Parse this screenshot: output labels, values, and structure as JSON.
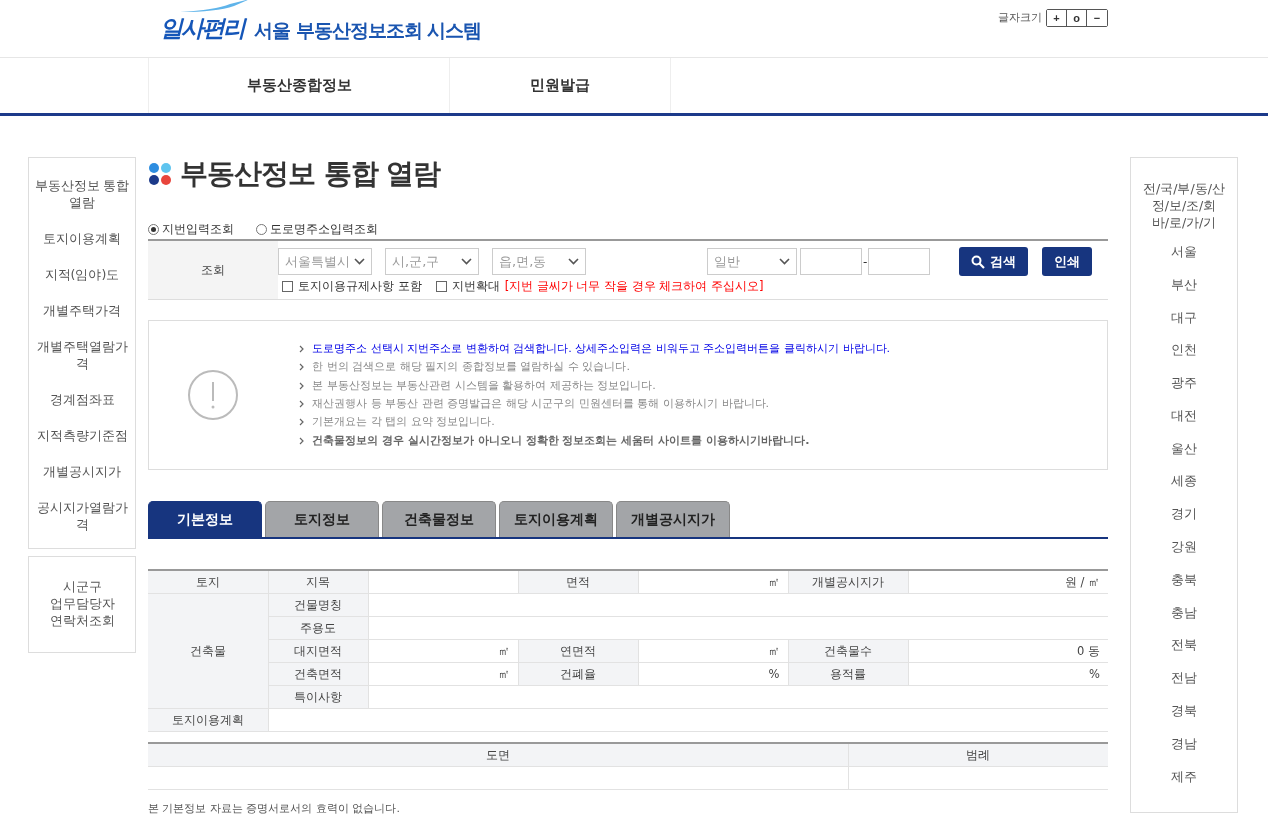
{
  "header": {
    "logo_text": "일사편리",
    "title": "서울 부동산정보조회 시스템",
    "font_size": {
      "label": "글자크기",
      "buttons": [
        "+",
        "o",
        "−"
      ]
    }
  },
  "nav": [
    "부동산종합정보",
    "민원발급"
  ],
  "left_menu": [
    "부동산정보 통합 열람",
    "토지이용계획",
    "지적(임야)도",
    "개별주택가격",
    "개별주택열람가격",
    "경계점좌표",
    "지적측량기준점",
    "개별공시지가",
    "공시지가열람가격"
  ],
  "contact_box": [
    "시군구",
    "업무담당자",
    "연락처조회"
  ],
  "page_title": "부동산정보 통합 열람",
  "search_modes": [
    {
      "label": "지번입력조회",
      "selected": true
    },
    {
      "label": "도로명주소입력조회",
      "selected": false
    }
  ],
  "search": {
    "label": "조회",
    "selects": [
      "서울특별시",
      "시,군,구",
      "읍,면,동"
    ],
    "lot_type": "일반",
    "separator": "-",
    "checkboxes": [
      {
        "label": "토지이용규제사항 포함",
        "checked": false
      },
      {
        "label": "지번확대",
        "checked": false,
        "note": "[지번 글씨가 너무 작을 경우 체크하여 주십시오]"
      }
    ],
    "buttons": [
      {
        "label": "검색",
        "kind": "search"
      },
      {
        "label": "인쇄",
        "kind": "plain"
      }
    ]
  },
  "notices": [
    {
      "text": "도로명주소 선택시 지번주소로 변환하여 검색합니다. 상세주소입력은 비워두고 주소입력버튼을 클릭하시기 바랍니다.",
      "kind": "highlight"
    },
    {
      "text": "한 번의 검색으로 해당 필지의 종합정보를 열람하실 수 있습니다.",
      "kind": "plain"
    },
    {
      "text": "본 부동산정보는 부동산관련 시스템을 활용하여 제공하는 정보입니다.",
      "kind": "plain"
    },
    {
      "text": "재산권행사 등 부동산 관련 증명발급은 해당 시군구의 민원센터를 통해 이용하시기 바랍니다.",
      "kind": "plain"
    },
    {
      "text": "기본개요는 각 탭의 요약 정보입니다.",
      "kind": "plain"
    },
    {
      "text": "건축물정보의 경우 실시간정보가 아니오니 정확한 정보조회는 세움터 사이트를 이용하시기바랍니다.",
      "kind": "strong"
    }
  ],
  "tabs": [
    {
      "label": "기본정보",
      "selected": true
    },
    {
      "label": "토지정보",
      "selected": false
    },
    {
      "label": "건축물정보",
      "selected": false
    },
    {
      "label": "토지이용계획",
      "selected": false
    },
    {
      "label": "개별공시지가",
      "selected": false
    }
  ],
  "info_table": {
    "rows": [
      {
        "group": "토지",
        "cells": [
          {
            "kind": "head",
            "text": "지목"
          },
          {
            "kind": "value"
          },
          {
            "kind": "head",
            "text": "면적"
          },
          {
            "kind": "value",
            "text": "㎡"
          },
          {
            "kind": "head",
            "text": "개별공시지가"
          },
          {
            "kind": "value",
            "text": "원 / ㎡"
          }
        ]
      },
      {
        "group": "건축물",
        "cells": [
          {
            "kind": "head",
            "text": "건물명칭"
          },
          {
            "kind": "wide"
          }
        ]
      },
      {
        "cells": [
          {
            "kind": "head",
            "text": "주용도"
          },
          {
            "kind": "wide"
          }
        ]
      },
      {
        "cells": [
          {
            "kind": "head",
            "text": "대지면적"
          },
          {
            "kind": "value",
            "text": "㎡"
          },
          {
            "kind": "head",
            "text": "연면적"
          },
          {
            "kind": "value",
            "text": "㎡"
          },
          {
            "kind": "head",
            "text": "건축물수"
          },
          {
            "kind": "value",
            "text": "0 동"
          }
        ]
      },
      {
        "cells": [
          {
            "kind": "head",
            "text": "건축면적"
          },
          {
            "kind": "value",
            "text": "㎡"
          },
          {
            "kind": "head",
            "text": "건폐율"
          },
          {
            "kind": "value",
            "text": "%"
          },
          {
            "kind": "head",
            "text": "용적률"
          },
          {
            "kind": "value",
            "text": "%"
          }
        ]
      },
      {
        "cells": [
          {
            "kind": "head",
            "text": "특이사항"
          },
          {
            "kind": "wide"
          }
        ]
      },
      {
        "group": "토지이용계획",
        "cells": [
          {
            "kind": "full"
          }
        ]
      }
    ]
  },
  "drawing_table": {
    "columns": [
      "도면",
      "범례"
    ]
  },
  "footnote": "본 기본정보 자료는 증명서로서의 효력이 없습니다.",
  "right_menu": {
    "title": [
      "전/국/부/동/산",
      "정/보/조/회",
      "바/로/가/기"
    ],
    "items": [
      "서울",
      "부산",
      "대구",
      "인천",
      "광주",
      "대전",
      "울산",
      "세종",
      "경기",
      "강원",
      "충북",
      "충남",
      "전북",
      "전남",
      "경북",
      "경남",
      "제주"
    ]
  }
}
